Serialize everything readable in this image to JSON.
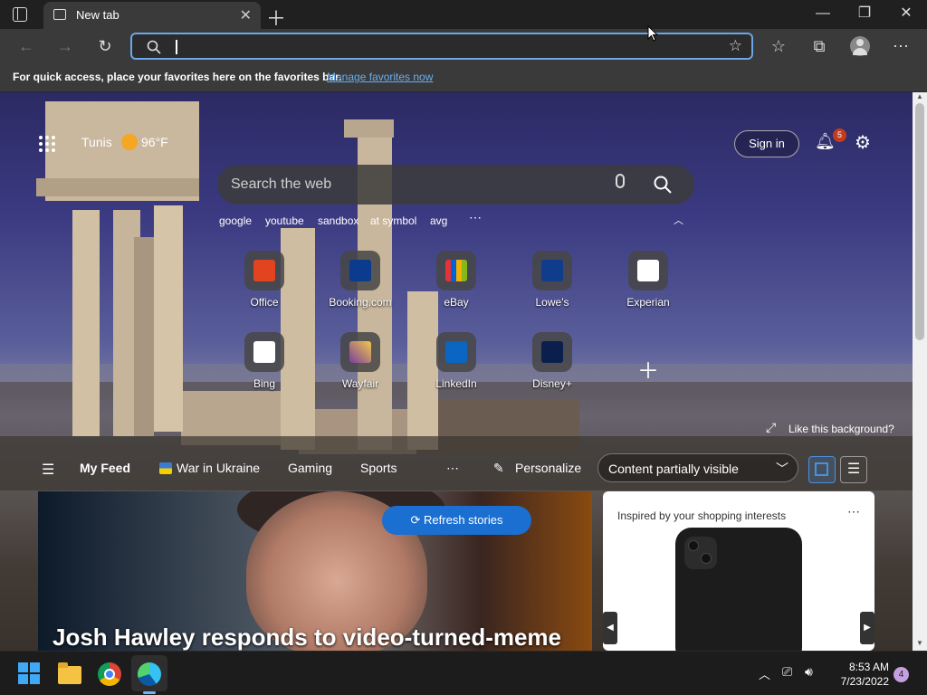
{
  "browser": {
    "tab_title": "New tab",
    "address_value": "",
    "favbar_message": "For quick access, place your favorites here on the favorites bar.",
    "favbar_link": "Manage favorites now"
  },
  "newtab": {
    "weather_city": "Tunis",
    "weather_temp": "96°F",
    "sign_in": "Sign in",
    "notification_count": "5",
    "search_placeholder": "Search the web",
    "suggestions": [
      "google",
      "youtube",
      "sandbox",
      "at symbol",
      "avg"
    ],
    "quick_links": [
      {
        "label": "Office",
        "color": "#e2441f"
      },
      {
        "label": "Booking.com",
        "color": "#0b3b8c"
      },
      {
        "label": "eBay",
        "color": "#e53238"
      },
      {
        "label": "Lowe's",
        "color": "#0f3d8c"
      },
      {
        "label": "Experian",
        "color": "#ffffff"
      },
      {
        "label": "Bing",
        "color": "#ffffff"
      },
      {
        "label": "Wayfair",
        "color": "#7a3e9d"
      },
      {
        "label": "LinkedIn",
        "color": "#0a66c2"
      },
      {
        "label": "Disney+",
        "color": "#0b1f4d"
      }
    ],
    "like_background": "Like this background?",
    "feed": {
      "my_feed": "My Feed",
      "tabs": [
        "War in Ukraine",
        "Gaming",
        "Sports"
      ],
      "personalize": "Personalize",
      "content_visibility": "Content partially visible"
    },
    "refresh_stories": "Refresh stories",
    "headline": "Josh Hawley responds to video-turned-meme",
    "shopping_title": "Inspired by your shopping interests"
  },
  "taskbar": {
    "time": "8:53 AM",
    "date": "7/23/2022",
    "notification_count": "4"
  },
  "colors": {
    "accent": "#1a6fd0",
    "address_border": "#6aa6e8"
  }
}
